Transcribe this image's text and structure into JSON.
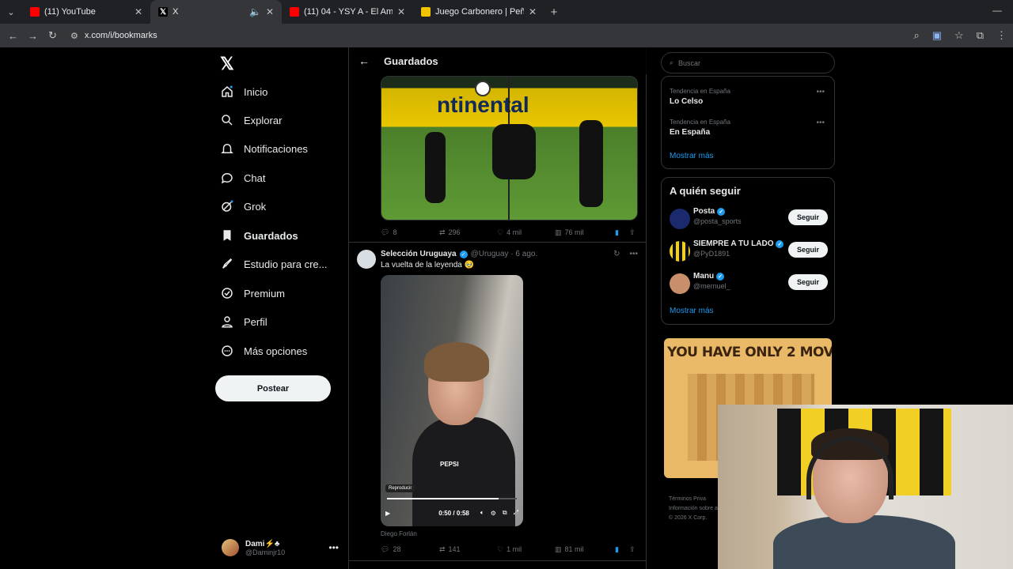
{
  "browser": {
    "tabs": [
      {
        "title": "(11) YouTube",
        "favicon_color": "#ff0000",
        "active": false
      },
      {
        "title": "X",
        "favicon_color": "#000000",
        "active": true
      },
      {
        "title": "(11) 04 - YSY A - El Amanecer |",
        "favicon_color": "#ff0000",
        "active": false
      },
      {
        "title": "Juego Carbonero | Peñarol",
        "favicon_color": "#f4c300",
        "active": false
      }
    ],
    "url": "x.com/i/bookmarks"
  },
  "sidebar": {
    "logo": "𝕏",
    "items": [
      {
        "label": "Inicio",
        "icon": "home-icon"
      },
      {
        "label": "Explorar",
        "icon": "search-icon"
      },
      {
        "label": "Notificaciones",
        "icon": "bell-icon"
      },
      {
        "label": "Chat",
        "icon": "chat-icon"
      },
      {
        "label": "Grok",
        "icon": "grok-icon"
      },
      {
        "label": "Guardados",
        "icon": "bookmark-icon",
        "active": true
      },
      {
        "label": "Estudio para cre...",
        "icon": "rocket-icon"
      },
      {
        "label": "Premium",
        "icon": "premium-icon"
      },
      {
        "label": "Perfil",
        "icon": "person-icon"
      },
      {
        "label": "Más opciones",
        "icon": "more-icon"
      }
    ],
    "post_button": "Postear",
    "account": {
      "name": "Dami⚡♣",
      "handle": "@Daminjr10"
    }
  },
  "main": {
    "title": "Guardados",
    "tweet1": {
      "replies": "8",
      "retweets": "296",
      "likes": "4 mil",
      "views": "76 mil"
    },
    "tweet2": {
      "name": "Selección Uruguaya",
      "meta": "@Uruguay · 6 ago.",
      "text": "La vuelta de la leyenda 🥹",
      "video_label": "PEPSI",
      "play_label": "Reproducir",
      "time": "0:50 / 0:58",
      "progress": 0.862,
      "caption": "Diego Forlán",
      "replies": "28",
      "retweets": "141",
      "likes": "1 mil",
      "views": "81 mil"
    }
  },
  "right": {
    "search_placeholder": "Buscar",
    "trends": [
      {
        "context": "Tendencia en España",
        "name": "Lo Celso"
      },
      {
        "context": "Tendencia en España",
        "name": "En España"
      }
    ],
    "show_more": "Mostrar más",
    "who_to_follow": {
      "title": "A quién seguir",
      "users": [
        {
          "name": "Posta",
          "handle": "@posta_sports",
          "button": "Seguir",
          "avatar_color": "#1a2a6c"
        },
        {
          "name": "SIEMPRE A TU LADO",
          "handle": "@PyD1891",
          "button": "Seguir",
          "avatar_color": "#f1cf25"
        },
        {
          "name": "Manu",
          "handle": "@mernuel_",
          "button": "Seguir",
          "avatar_color": "#c98f6b"
        }
      ],
      "show_more": "Mostrar más"
    },
    "ad_text": "YOU HAVE ONLY 2 MOVES",
    "footer": {
      "line1": "Términos  Priva",
      "line2": "Información sobre a",
      "line3": "© 2026 X Corp."
    }
  },
  "colors": {
    "accent": "#1d9bf0",
    "background": "#000000",
    "border": "#2f3336"
  }
}
